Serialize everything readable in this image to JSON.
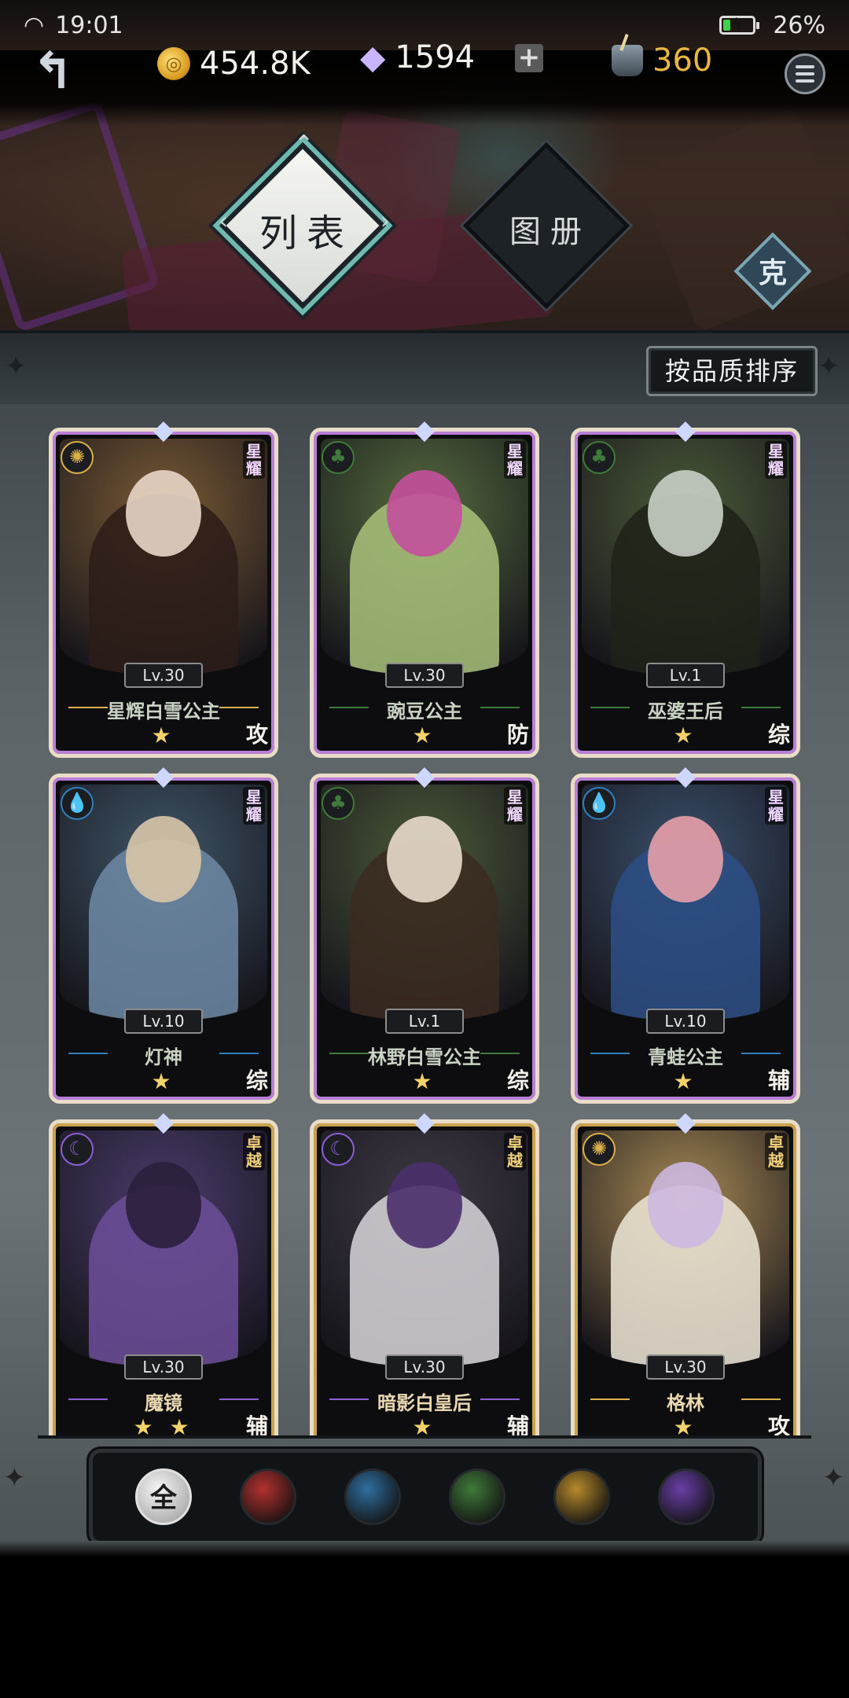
{
  "status_bar": {
    "time": "19:01",
    "battery": "26%",
    "battery_level": 0.26
  },
  "resources": {
    "gold": {
      "icon": "gold-coin-icon",
      "value": "454.8K"
    },
    "gems": {
      "icon": "diamond-gem-icon",
      "value": "1594",
      "add_label": "+"
    },
    "ink": {
      "icon": "ink-bottle-icon",
      "value": "360"
    }
  },
  "tabs": [
    {
      "label": "列表",
      "active": true
    },
    {
      "label": "图册",
      "active": false
    }
  ],
  "counter_label": "克",
  "sort_button": "按品质排序",
  "cards": [
    {
      "name": "星辉白雪公主",
      "level": "Lv.30",
      "rank": "星耀",
      "role": "攻",
      "stars": "★",
      "element": "light",
      "frame": "purple",
      "palette": [
        "#7a5a34",
        "#2b1c18",
        "#e8d6c8"
      ]
    },
    {
      "name": "豌豆公主",
      "level": "Lv.30",
      "rank": "星耀",
      "role": "防",
      "stars": "★",
      "element": "nature",
      "frame": "purple",
      "palette": [
        "#556b3f",
        "#a9c27a",
        "#c44f9c"
      ]
    },
    {
      "name": "巫婆王后",
      "level": "Lv.1",
      "rank": "星耀",
      "role": "综",
      "stars": "★",
      "element": "nature",
      "frame": "purple",
      "palette": [
        "#4b5a39",
        "#1e2218",
        "#c9cfc6"
      ]
    },
    {
      "name": "灯神",
      "level": "Lv.10",
      "rank": "星耀",
      "role": "综",
      "stars": "★",
      "element": "water",
      "frame": "purple",
      "palette": [
        "#3f5567",
        "#6f8aa6",
        "#d8c7a8"
      ]
    },
    {
      "name": "林野白雪公主",
      "level": "Lv.1",
      "rank": "星耀",
      "role": "综",
      "stars": "★",
      "element": "nature",
      "frame": "purple",
      "palette": [
        "#4a5838",
        "#3b2a20",
        "#e9dccb"
      ]
    },
    {
      "name": "青蛙公主",
      "level": "Lv.10",
      "rank": "星耀",
      "role": "辅",
      "stars": "★",
      "element": "water",
      "frame": "purple",
      "palette": [
        "#3a4f6b",
        "#2d4f86",
        "#e7a0a8"
      ]
    },
    {
      "name": "魔镜",
      "level": "Lv.30",
      "rank": "卓越",
      "role": "辅",
      "stars": "★ ★",
      "element": "dark",
      "frame": "gold",
      "palette": [
        "#4b3b6b",
        "#6d4f9a",
        "#2a1f3c"
      ]
    },
    {
      "name": "暗影白皇后",
      "level": "Lv.30",
      "rank": "卓越",
      "role": "辅",
      "stars": "★",
      "element": "dark",
      "frame": "gold",
      "palette": [
        "#3e3a45",
        "#d9d6dc",
        "#4a2f6b"
      ]
    },
    {
      "name": "格林",
      "level": "Lv.30",
      "rank": "卓越",
      "role": "攻",
      "stars": "★",
      "element": "light",
      "frame": "gold",
      "palette": [
        "#a88a55",
        "#efe7d8",
        "#cdb8e0"
      ]
    }
  ],
  "filters": [
    {
      "label": "全",
      "icon": "all-filter-icon",
      "color": "#dcdcdc"
    },
    {
      "label": "",
      "icon": "fire-element-icon",
      "color": "#b3312f"
    },
    {
      "label": "",
      "icon": "water-element-icon",
      "color": "#2f6fa0"
    },
    {
      "label": "",
      "icon": "nature-element-icon",
      "color": "#3f7a3a"
    },
    {
      "label": "",
      "icon": "light-element-icon",
      "color": "#b78a2b"
    },
    {
      "label": "",
      "icon": "dark-element-icon",
      "color": "#6a3fa8"
    }
  ],
  "element_glyphs": {
    "light": "✺",
    "nature": "♣",
    "water": "💧",
    "dark": "☾",
    "fire": "♨"
  },
  "element_colors": {
    "light": "#d9b04a",
    "nature": "#3f7a3a",
    "water": "#2f7fc0",
    "dark": "#8d5ed6",
    "fire": "#c2392f"
  }
}
